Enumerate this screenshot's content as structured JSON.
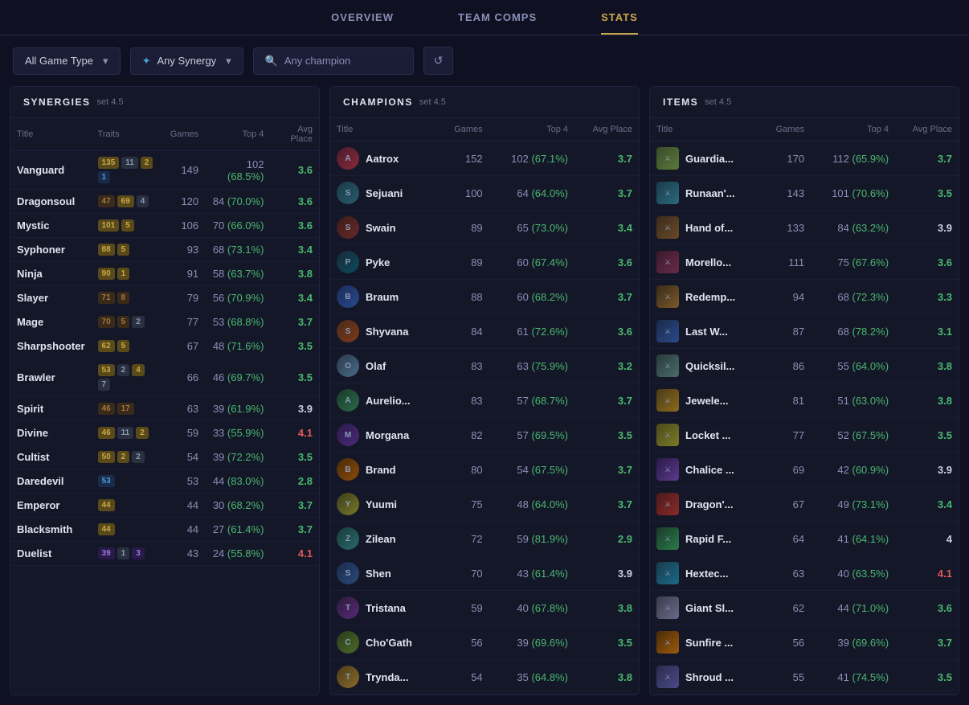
{
  "nav": {
    "tabs": [
      {
        "label": "OVERVIEW",
        "active": false
      },
      {
        "label": "TEAM COMPS",
        "active": false
      },
      {
        "label": "STATS",
        "active": true
      }
    ]
  },
  "filters": {
    "game_type_label": "All Game Type",
    "synergy_label": "Any Synergy",
    "champion_placeholder": "Any champion",
    "refresh_icon": "↺"
  },
  "synergies": {
    "title": "SYNERGIES",
    "set": "set 4.5",
    "columns": [
      "Title",
      "Traits",
      "Games",
      "Top 4",
      "Avg Place"
    ],
    "rows": [
      {
        "title": "Vanguard",
        "traits": [
          {
            "label": "135",
            "type": "gold"
          },
          {
            "label": "11",
            "type": "silver"
          },
          {
            "label": "2",
            "type": "gold"
          },
          {
            "label": "1",
            "type": "blue"
          }
        ],
        "games": 149,
        "top4": "102 (68.5%)",
        "avg": "3.6",
        "avg_class": "avg-good"
      },
      {
        "title": "Dragonsoul",
        "traits": [
          {
            "label": "47",
            "type": "bronze"
          },
          {
            "label": "69",
            "type": "gold"
          },
          {
            "label": "4",
            "type": "silver"
          }
        ],
        "games": 120,
        "top4": "84 (70.0%)",
        "avg": "3.6",
        "avg_class": "avg-good"
      },
      {
        "title": "Mystic",
        "traits": [
          {
            "label": "101",
            "type": "gold"
          },
          {
            "label": "5",
            "type": "gold"
          }
        ],
        "games": 106,
        "top4": "70 (66.0%)",
        "avg": "3.6",
        "avg_class": "avg-good"
      },
      {
        "title": "Syphoner",
        "traits": [
          {
            "label": "88",
            "type": "gold"
          },
          {
            "label": "5",
            "type": "gold"
          }
        ],
        "games": 93,
        "top4": "68 (73.1%)",
        "avg": "3.4",
        "avg_class": "avg-good"
      },
      {
        "title": "Ninja",
        "traits": [
          {
            "label": "90",
            "type": "gold"
          },
          {
            "label": "1",
            "type": "gold"
          }
        ],
        "games": 91,
        "top4": "58 (63.7%)",
        "avg": "3.8",
        "avg_class": "avg-good"
      },
      {
        "title": "Slayer",
        "traits": [
          {
            "label": "71",
            "type": "bronze"
          },
          {
            "label": "8",
            "type": "bronze"
          }
        ],
        "games": 79,
        "top4": "56 (70.9%)",
        "avg": "3.4",
        "avg_class": "avg-good"
      },
      {
        "title": "Mage",
        "traits": [
          {
            "label": "70",
            "type": "bronze"
          },
          {
            "label": "5",
            "type": "bronze"
          },
          {
            "label": "2",
            "type": "silver"
          }
        ],
        "games": 77,
        "top4": "53 (68.8%)",
        "avg": "3.7",
        "avg_class": "avg-good"
      },
      {
        "title": "Sharpshooter",
        "traits": [
          {
            "label": "62",
            "type": "gold"
          },
          {
            "label": "5",
            "type": "gold"
          }
        ],
        "games": 67,
        "top4": "48 (71.6%)",
        "avg": "3.5",
        "avg_class": "avg-good"
      },
      {
        "title": "Brawler",
        "traits": [
          {
            "label": "53",
            "type": "gold"
          },
          {
            "label": "2",
            "type": "silver"
          },
          {
            "label": "4",
            "type": "gold"
          },
          {
            "label": "7",
            "type": "silver"
          }
        ],
        "games": 66,
        "top4": "46 (69.7%)",
        "avg": "3.5",
        "avg_class": "avg-good"
      },
      {
        "title": "Spirit",
        "traits": [
          {
            "label": "46",
            "type": "bronze"
          },
          {
            "label": "17",
            "type": "bronze"
          }
        ],
        "games": 63,
        "top4": "39 (61.9%)",
        "avg": "3.9",
        "avg_class": "avg-neutral"
      },
      {
        "title": "Divine",
        "traits": [
          {
            "label": "46",
            "type": "gold"
          },
          {
            "label": "11",
            "type": "silver"
          },
          {
            "label": "2",
            "type": "gold"
          }
        ],
        "games": 59,
        "top4": "33 (55.9%)",
        "avg": "4.1",
        "avg_class": "avg-bad"
      },
      {
        "title": "Cultist",
        "traits": [
          {
            "label": "50",
            "type": "gold"
          },
          {
            "label": "2",
            "type": "gold"
          },
          {
            "label": "2",
            "type": "silver"
          }
        ],
        "games": 54,
        "top4": "39 (72.2%)",
        "avg": "3.5",
        "avg_class": "avg-good"
      },
      {
        "title": "Daredevil",
        "traits": [
          {
            "label": "53",
            "type": "blue"
          }
        ],
        "games": 53,
        "top4": "44 (83.0%)",
        "avg": "2.8",
        "avg_class": "avg-good"
      },
      {
        "title": "Emperor",
        "traits": [
          {
            "label": "44",
            "type": "gold"
          }
        ],
        "games": 44,
        "top4": "30 (68.2%)",
        "avg": "3.7",
        "avg_class": "avg-good"
      },
      {
        "title": "Blacksmith",
        "traits": [
          {
            "label": "44",
            "type": "gold"
          }
        ],
        "games": 44,
        "top4": "27 (61.4%)",
        "avg": "3.7",
        "avg_class": "avg-good"
      },
      {
        "title": "Duelist",
        "traits": [
          {
            "label": "39",
            "type": "purple"
          },
          {
            "label": "1",
            "type": "silver"
          },
          {
            "label": "3",
            "type": "purple"
          }
        ],
        "games": 43,
        "top4": "24 (55.8%)",
        "avg": "4.1",
        "avg_class": "avg-bad"
      }
    ]
  },
  "champions": {
    "title": "CHAMPIONS",
    "set": "set 4.5",
    "columns": [
      "Title",
      "Games",
      "Top 4",
      "Avg Place"
    ],
    "rows": [
      {
        "title": "Aatrox",
        "avatar_class": "av-aatrox",
        "games": 152,
        "top4": "102 (67.1%)",
        "avg": "3.7",
        "avg_class": "avg-good"
      },
      {
        "title": "Sejuani",
        "avatar_class": "av-sejuani",
        "games": 100,
        "top4": "64 (64.0%)",
        "avg": "3.7",
        "avg_class": "avg-good"
      },
      {
        "title": "Swain",
        "avatar_class": "av-swain",
        "games": 89,
        "top4": "65 (73.0%)",
        "avg": "3.4",
        "avg_class": "avg-good"
      },
      {
        "title": "Pyke",
        "avatar_class": "av-pyke",
        "games": 89,
        "top4": "60 (67.4%)",
        "avg": "3.6",
        "avg_class": "avg-good"
      },
      {
        "title": "Braum",
        "avatar_class": "av-braum",
        "games": 88,
        "top4": "60 (68.2%)",
        "avg": "3.7",
        "avg_class": "avg-good"
      },
      {
        "title": "Shyvana",
        "avatar_class": "av-shyvana",
        "games": 84,
        "top4": "61 (72.6%)",
        "avg": "3.6",
        "avg_class": "avg-good"
      },
      {
        "title": "Olaf",
        "avatar_class": "av-olaf",
        "games": 83,
        "top4": "63 (75.9%)",
        "avg": "3.2",
        "avg_class": "avg-good"
      },
      {
        "title": "Aurelio...",
        "avatar_class": "av-aurelio",
        "games": 83,
        "top4": "57 (68.7%)",
        "avg": "3.7",
        "avg_class": "avg-good"
      },
      {
        "title": "Morgana",
        "avatar_class": "av-morgana",
        "games": 82,
        "top4": "57 (69.5%)",
        "avg": "3.5",
        "avg_class": "avg-good"
      },
      {
        "title": "Brand",
        "avatar_class": "av-brand",
        "games": 80,
        "top4": "54 (67.5%)",
        "avg": "3.7",
        "avg_class": "avg-good"
      },
      {
        "title": "Yuumi",
        "avatar_class": "av-yuumi",
        "games": 75,
        "top4": "48 (64.0%)",
        "avg": "3.7",
        "avg_class": "avg-good"
      },
      {
        "title": "Zilean",
        "avatar_class": "av-zilean",
        "games": 72,
        "top4": "59 (81.9%)",
        "avg": "2.9",
        "avg_class": "avg-good"
      },
      {
        "title": "Shen",
        "avatar_class": "av-shen",
        "games": 70,
        "top4": "43 (61.4%)",
        "avg": "3.9",
        "avg_class": "avg-neutral"
      },
      {
        "title": "Tristana",
        "avatar_class": "av-tristana",
        "games": 59,
        "top4": "40 (67.8%)",
        "avg": "3.8",
        "avg_class": "avg-good"
      },
      {
        "title": "Cho'Gath",
        "avatar_class": "av-chogath",
        "games": 56,
        "top4": "39 (69.6%)",
        "avg": "3.5",
        "avg_class": "avg-good"
      },
      {
        "title": "Trynda...",
        "avatar_class": "av-tryndamere",
        "games": 54,
        "top4": "35 (64.8%)",
        "avg": "3.8",
        "avg_class": "avg-good"
      }
    ]
  },
  "items": {
    "title": "ITEMS",
    "set": "set 4.5",
    "columns": [
      "Title",
      "Games",
      "Top 4",
      "Avg Place"
    ],
    "rows": [
      {
        "title": "Guardia...",
        "icon_class": "it-guardian",
        "games": 170,
        "top4": "112 (65.9%)",
        "avg": "3.7",
        "avg_class": "avg-good"
      },
      {
        "title": "Runaan'...",
        "icon_class": "it-runaan",
        "games": 143,
        "top4": "101 (70.6%)",
        "avg": "3.5",
        "avg_class": "avg-good"
      },
      {
        "title": "Hand of...",
        "icon_class": "it-hand",
        "games": 133,
        "top4": "84 (63.2%)",
        "avg": "3.9",
        "avg_class": "avg-neutral"
      },
      {
        "title": "Morello...",
        "icon_class": "it-morello",
        "games": 111,
        "top4": "75 (67.6%)",
        "avg": "3.6",
        "avg_class": "avg-good"
      },
      {
        "title": "Redemp...",
        "icon_class": "it-redemp",
        "games": 94,
        "top4": "68 (72.3%)",
        "avg": "3.3",
        "avg_class": "avg-good"
      },
      {
        "title": "Last W...",
        "icon_class": "it-lastw",
        "games": 87,
        "top4": "68 (78.2%)",
        "avg": "3.1",
        "avg_class": "avg-good"
      },
      {
        "title": "Quicksil...",
        "icon_class": "it-quicksil",
        "games": 86,
        "top4": "55 (64.0%)",
        "avg": "3.8",
        "avg_class": "avg-good"
      },
      {
        "title": "Jewele...",
        "icon_class": "it-jeweled",
        "games": 81,
        "top4": "51 (63.0%)",
        "avg": "3.8",
        "avg_class": "avg-good"
      },
      {
        "title": "Locket ...",
        "icon_class": "it-locket",
        "games": 77,
        "top4": "52 (67.5%)",
        "avg": "3.5",
        "avg_class": "avg-good"
      },
      {
        "title": "Chalice ...",
        "icon_class": "it-chalice",
        "games": 69,
        "top4": "42 (60.9%)",
        "avg": "3.9",
        "avg_class": "avg-neutral"
      },
      {
        "title": "Dragon'...",
        "icon_class": "it-dragon",
        "games": 67,
        "top4": "49 (73.1%)",
        "avg": "3.4",
        "avg_class": "avg-good"
      },
      {
        "title": "Rapid F...",
        "icon_class": "it-rapid",
        "games": 64,
        "top4": "41 (64.1%)",
        "avg": "4",
        "avg_class": "avg-neutral"
      },
      {
        "title": "Hextec...",
        "icon_class": "it-hextec",
        "games": 63,
        "top4": "40 (63.5%)",
        "avg": "4.1",
        "avg_class": "avg-bad"
      },
      {
        "title": "Giant Sl...",
        "icon_class": "it-giantsl",
        "games": 62,
        "top4": "44 (71.0%)",
        "avg": "3.6",
        "avg_class": "avg-good"
      },
      {
        "title": "Sunfire ...",
        "icon_class": "it-sunfire",
        "games": 56,
        "top4": "39 (69.6%)",
        "avg": "3.7",
        "avg_class": "avg-good"
      },
      {
        "title": "Shroud ...",
        "icon_class": "it-shroud",
        "games": 55,
        "top4": "41 (74.5%)",
        "avg": "3.5",
        "avg_class": "avg-good"
      }
    ]
  }
}
